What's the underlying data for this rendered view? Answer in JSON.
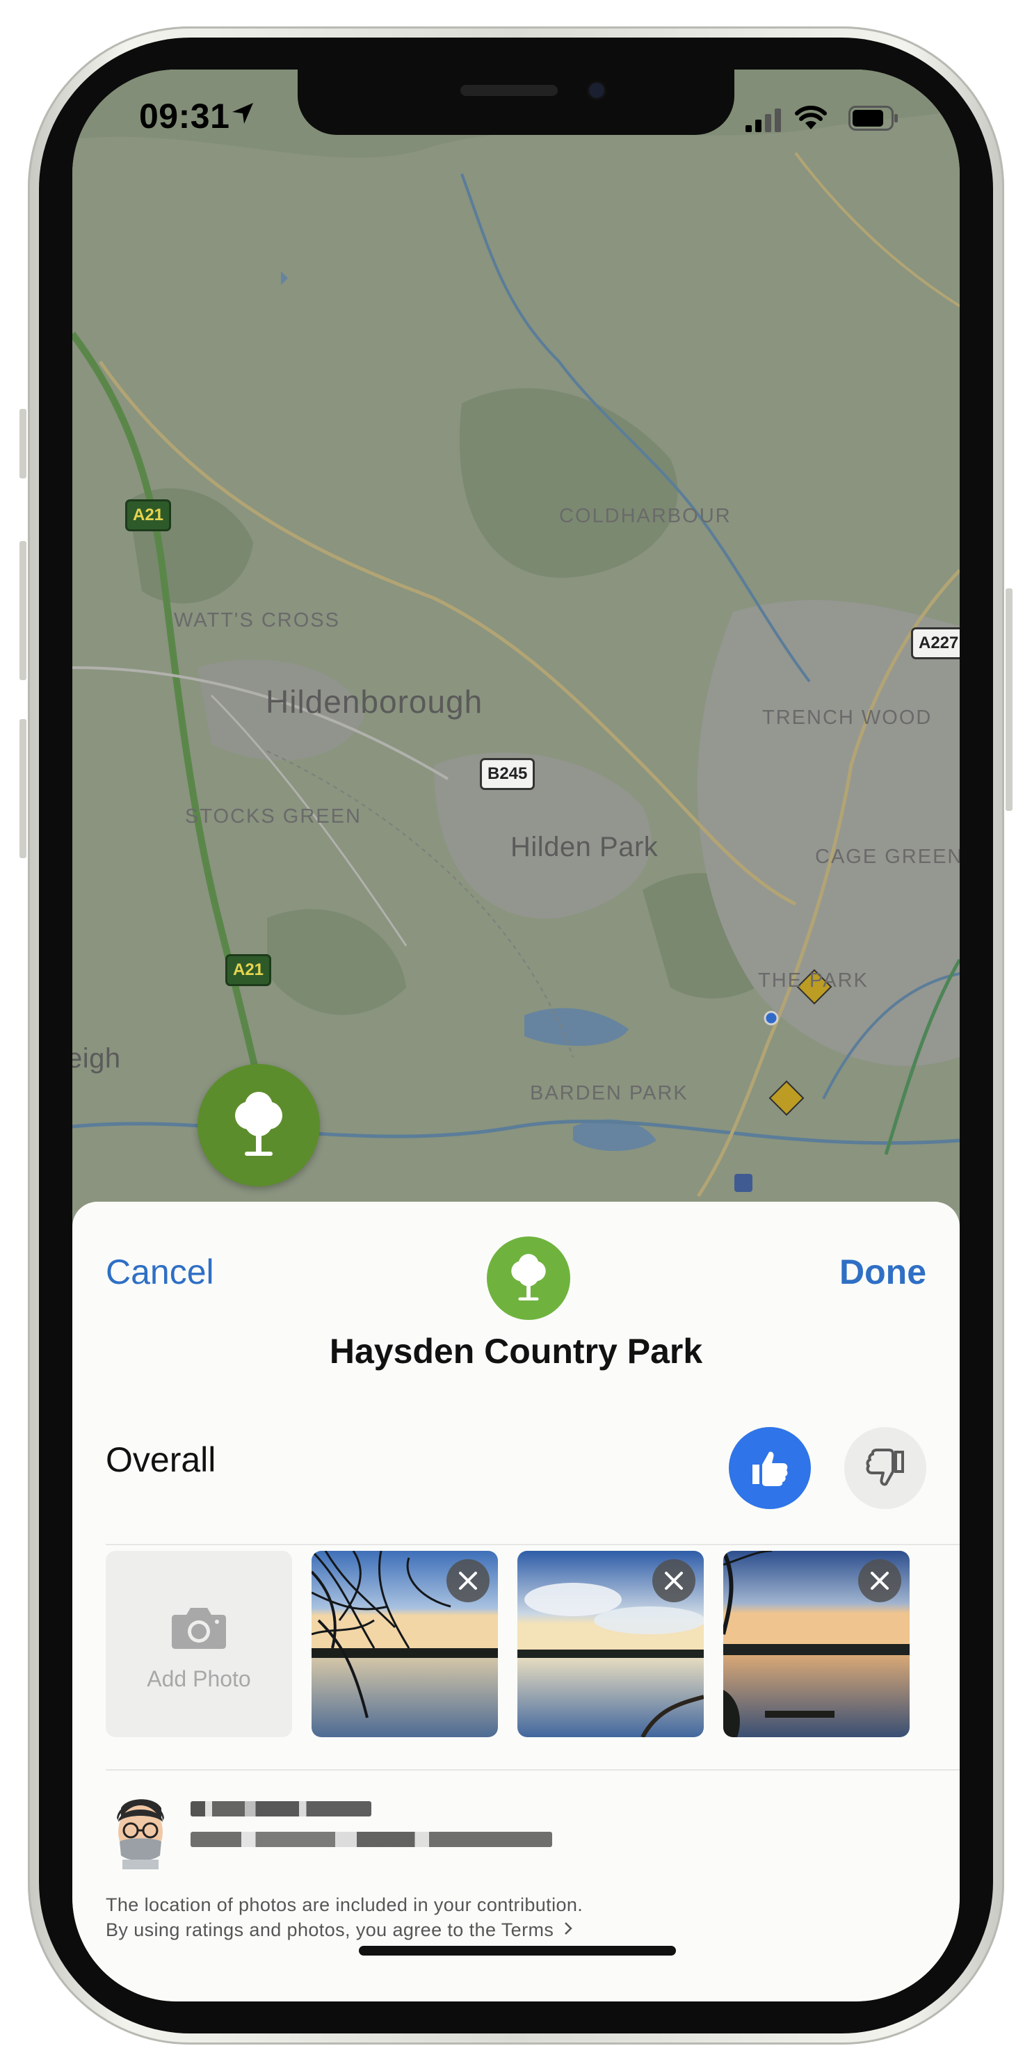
{
  "status_bar": {
    "time": "09:31"
  },
  "map": {
    "labels": {
      "coldharbour": "COLDHARBOUR",
      "watts_cross": "WATT'S CROSS",
      "hildenborough": "Hildenborough",
      "trench_wood": "TRENCH WOOD",
      "stocks_green": "STOCKS GREEN",
      "hilden_park": "Hilden Park",
      "cage_green": "CAGE GREEN",
      "the_park": "THE PARK",
      "eigh": "eigh",
      "barden_park": "BARDEN PARK"
    },
    "roads": {
      "a21_top": "A21",
      "a21_bottom": "A21",
      "b245": "B245",
      "a227": "A227"
    }
  },
  "sheet": {
    "cancel_label": "Cancel",
    "done_label": "Done",
    "place_name": "Haysden Country Park",
    "overall_label": "Overall",
    "rating": "thumbs-up",
    "add_photo_label": "Add Photo",
    "photo_count": 3,
    "footnote_line1": "The location of photos are included in your contribution.",
    "footnote_line2": "By using ratings and photos, you agree to the Terms"
  },
  "colors": {
    "accent": "#2f6fc5",
    "thumbs_up_bg": "#2f74e8",
    "place_icon_bg": "#6fb33e",
    "map_pin_bg": "#5c8d2c"
  },
  "icons": [
    "location-arrow-icon",
    "signal-icon",
    "wifi-icon",
    "battery-icon",
    "tree-icon",
    "thumbs-up-icon",
    "thumbs-down-icon",
    "camera-icon",
    "close-icon",
    "chevron-right-icon"
  ]
}
